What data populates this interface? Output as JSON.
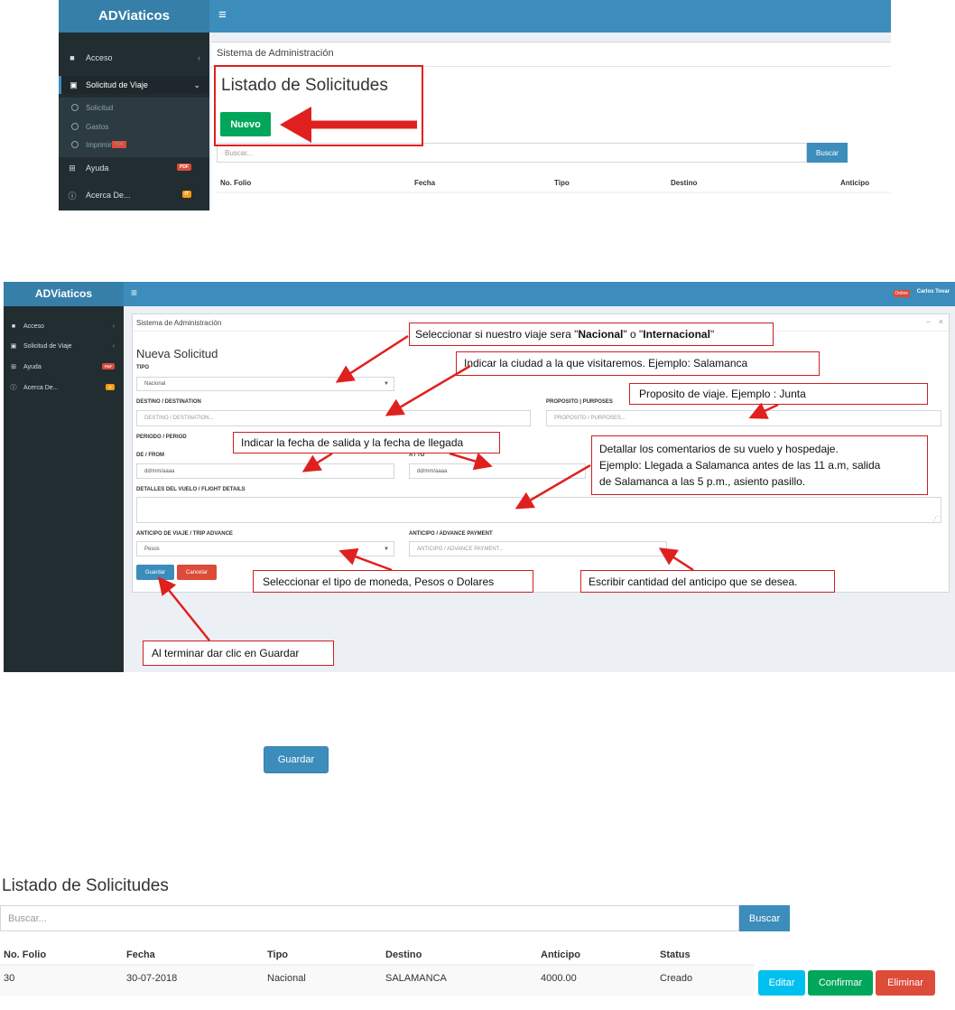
{
  "app": {
    "brand": "ADViaticos",
    "menu_icon": "hamburger-icon"
  },
  "screen1": {
    "sidebar": {
      "items": [
        {
          "label": "Acceso",
          "icon": "folder-icon"
        },
        {
          "label": "Solicitud de Viaje",
          "icon": "briefcase-icon"
        },
        {
          "label": "Ayuda",
          "icon": "plus-square-icon",
          "badge": "PDF"
        },
        {
          "label": "Acerca De...",
          "icon": "info-icon",
          "badge": "IT"
        }
      ],
      "subitems": [
        {
          "label": "Solicitud"
        },
        {
          "label": "Gastos"
        },
        {
          "label": "Imprimir",
          "badge": "PDF"
        }
      ]
    },
    "breadcrumb": "Sistema de Administración",
    "title": "Listado de Solicitudes",
    "new_button": "Nuevo",
    "search_placeholder": "Buscar...",
    "search_button": "Buscar",
    "columns": [
      "No. Folio",
      "Fecha",
      "Tipo",
      "Destino",
      "Anticipo"
    ]
  },
  "screen2": {
    "user_status": "Online",
    "user_name": "Carlos Tovar",
    "sidebar": {
      "items": [
        {
          "label": "Acceso"
        },
        {
          "label": "Solicitud de Viaje"
        },
        {
          "label": "Ayuda",
          "badge": "PDF"
        },
        {
          "label": "Acerca De...",
          "badge": "IT"
        }
      ]
    },
    "breadcrumb": "Sistema de Administración",
    "window_controls": {
      "minimize": "−",
      "close": "×"
    },
    "form_title": "Nueva Solicitud",
    "tipo_label": "TIPO",
    "tipo_value": "Nacional",
    "destino_label": "DESTINO / DESTINATION",
    "destino_placeholder": "DESTINO / DESTINATION...",
    "proposito_label": "PROPOSITO | PURPOSES",
    "proposito_placeholder": "PROPOSITO / PURPOSES...",
    "periodo_label": "PERIODO / PERIOD",
    "de_label": "DE / FROM",
    "de_placeholder": "dd/mm/aaaa",
    "a_label": "A / TO",
    "a_placeholder": "dd/mm/aaaa",
    "detalles_label": "DETALLES DEL VUELO / FLIGHT DETAILS",
    "anticipo_viaje_label": "ANTICIPO DE VIAJE / TRIP ADVANCE",
    "anticipo_viaje_value": "Pesos",
    "anticipo_pago_label": "ANTICIPO / ADVANCE PAYMENT",
    "anticipo_pago_placeholder": "ANTICIPO / ADVANCE PAYMENT...",
    "save_button": "Guardar",
    "cancel_button": "Cancelar"
  },
  "callouts": {
    "tipo_pre": "Seleccionar si nuestro viaje sera \"",
    "tipo_bold1": "Nacional",
    "tipo_mid": "\" o \"",
    "tipo_bold2": "Internacional",
    "tipo_post": "\"",
    "destino": "Indicar la ciudad a la que visitaremos.  Ejemplo: Salamanca",
    "proposito": "Proposito de viaje. Ejemplo : Junta",
    "fechas": "Indicar la fecha de salida y la fecha de llegada",
    "detalles_1": "Detallar los comentarios de su vuelo y hospedaje.",
    "detalles_2": "Ejemplo: Llegada a Salamanca antes de las 11 a.m, salida",
    "detalles_3": "de Salamanca a las 5 p.m., asiento pasillo.",
    "moneda": "Seleccionar el tipo de moneda, Pesos o Dolares",
    "anticipo": "Escribir cantidad del anticipo que se desea.",
    "guardar": "Al terminar dar clic en Guardar",
    "arrow_color": "#e0201e"
  },
  "screen3": {
    "save_button": "Guardar"
  },
  "screen4": {
    "title": "Listado de Solicitudes",
    "search_placeholder": "Buscar...",
    "search_button": "Buscar",
    "columns": [
      "No. Folio",
      "Fecha",
      "Tipo",
      "Destino",
      "Anticipo",
      "Status"
    ],
    "row": {
      "folio": "30",
      "fecha": "30-07-2018",
      "tipo": "Nacional",
      "destino": "SALAMANCA",
      "anticipo": "4000.00",
      "status": "Creado"
    },
    "actions": {
      "edit": "Editar",
      "confirm": "Confirmar",
      "delete": "Eliminar"
    }
  }
}
